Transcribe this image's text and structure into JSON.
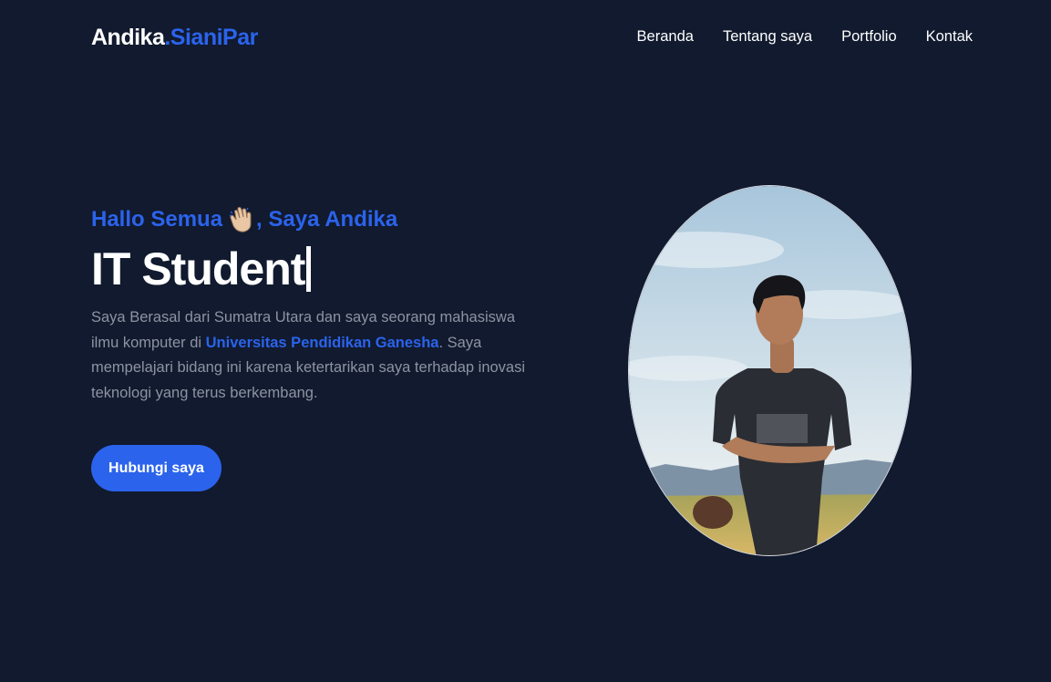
{
  "brand": {
    "first": "Andika",
    "second": ".SianiPar"
  },
  "nav": {
    "items": [
      "Beranda",
      "Tentang saya",
      "Portfolio",
      "Kontak"
    ]
  },
  "hero": {
    "greeting_pre": "Hallo Semua",
    "greeting_post": ", Saya Andika",
    "greeting_emoji": "waving-hand-icon",
    "title": "IT Student",
    "desc_part1": "Saya Berasal dari Sumatra Utara dan saya seorang mahasiswa ilmu komputer di ",
    "desc_highlight": "Universitas Pendidikan Ganesha",
    "desc_part2": ". Saya mempelajari bidang ini karena ketertarikan saya terhadap inovasi teknologi yang terus berkembang.",
    "cta_label": "Hubungi saya"
  },
  "colors": {
    "background": "#111a2e",
    "accent": "#2b63ec",
    "text_muted": "#8d93a3",
    "text_primary": "#ffffff"
  }
}
